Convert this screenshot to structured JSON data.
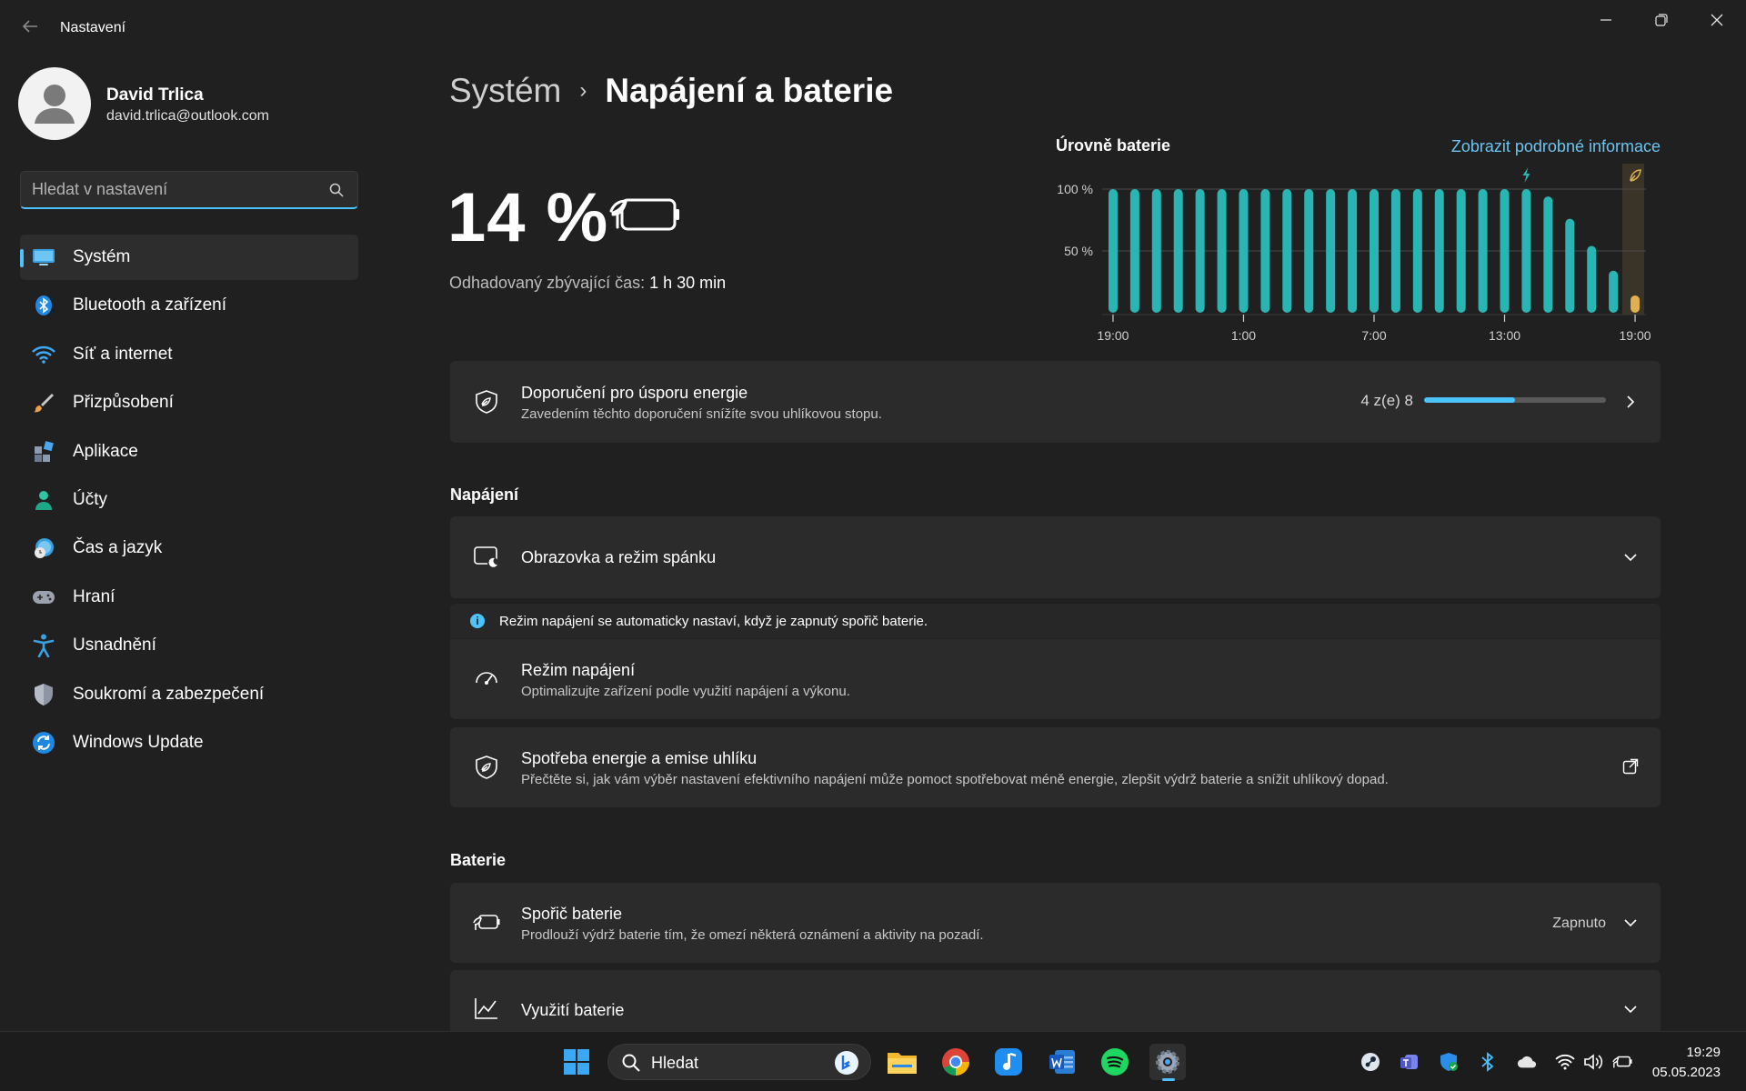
{
  "window": {
    "title": "Nastavení",
    "back_icon": "back-arrow-icon",
    "controls": [
      "minimize-icon",
      "maximize-icon",
      "close-icon"
    ]
  },
  "profile": {
    "name": "David Trlica",
    "email": "david.trlica@outlook.com"
  },
  "search": {
    "placeholder": "Hledat v nastavení",
    "icon": "search-icon"
  },
  "sidebar": {
    "items": [
      {
        "label": "Systém",
        "icon": "system-icon",
        "active": true
      },
      {
        "label": "Bluetooth a zařízení",
        "icon": "bluetooth-icon"
      },
      {
        "label": "Síť a internet",
        "icon": "wifi-icon"
      },
      {
        "label": "Přizpůsobení",
        "icon": "brush-icon"
      },
      {
        "label": "Aplikace",
        "icon": "apps-icon"
      },
      {
        "label": "Účty",
        "icon": "account-icon"
      },
      {
        "label": "Čas a jazyk",
        "icon": "time-language-icon"
      },
      {
        "label": "Hraní",
        "icon": "gamepad-icon"
      },
      {
        "label": "Usnadnění",
        "icon": "accessibility-icon"
      },
      {
        "label": "Soukromí a zabezpečení",
        "icon": "shield-icon"
      },
      {
        "label": "Windows Update",
        "icon": "update-icon"
      }
    ]
  },
  "breadcrumb": {
    "parent": "Systém",
    "separator": "›",
    "current": "Napájení a baterie"
  },
  "battery": {
    "percent": "14 %",
    "estimate_label": "Odhadovaný zbývající čas:",
    "estimate_value": "1 h 30 min"
  },
  "chart_data": {
    "type": "bar",
    "title": "Úrovně baterie",
    "link": "Zobrazit podrobné informace",
    "y_tick_labels": [
      "100 %",
      "50 %"
    ],
    "x_tick_labels": [
      "19:00",
      "1:00",
      "7:00",
      "13:00",
      "19:00"
    ],
    "ylim": [
      0,
      100
    ],
    "values": [
      100,
      100,
      100,
      100,
      100,
      100,
      100,
      100,
      100,
      100,
      100,
      100,
      100,
      100,
      100,
      100,
      100,
      100,
      100,
      100,
      94,
      76,
      54,
      34,
      14
    ],
    "colors": {
      "normal": "#2ab5b5",
      "saver": "#e0b050"
    },
    "markers": [
      "charging-bolt-icon",
      "battery-saver-leaf-icon"
    ]
  },
  "recommendations": {
    "title": "Doporučení pro úsporu energie",
    "subtitle": "Zavedením těchto doporučení snížíte svou uhlíkovou stopu.",
    "progress_text": "4 z(e) 8",
    "progress_fraction": 0.5
  },
  "power_section": {
    "label": "Napájení",
    "screen_sleep": {
      "title": "Obrazovka a režim spánku"
    },
    "info_text": "Režim napájení se automaticky nastaví, když je zapnutý spořič baterie.",
    "power_mode": {
      "title": "Režim napájení",
      "subtitle": "Optimalizujte zařízení podle využití napájení a výkonu."
    },
    "consumption": {
      "title": "Spotřeba energie a emise uhlíku",
      "subtitle": "Přečtěte si, jak vám výběr nastavení efektivního napájení může pomoct spotřebovat méně energie, zlepšit výdrž baterie a snížit uhlíkový dopad."
    }
  },
  "battery_section": {
    "label": "Baterie",
    "saver": {
      "title": "Spořič baterie",
      "subtitle": "Prodlouží výdrž baterie tím, že omezí některá oznámení a aktivity na pozadí.",
      "status": "Zapnuto"
    },
    "usage": {
      "title": "Využití baterie"
    }
  },
  "taskbar": {
    "search_label": "Hledat",
    "apps": [
      "windows-start-icon",
      "bing-icon",
      "file-explorer-icon",
      "chrome-icon",
      "music-app-icon",
      "word-icon",
      "spotify-icon",
      "settings-icon"
    ],
    "tray": [
      "steam-icon",
      "teams-icon",
      "defender-icon",
      "bluetooth-icon",
      "onedrive-icon",
      "wifi-icon",
      "volume-icon",
      "battery-icon"
    ],
    "time": "19:29",
    "date": "05.05.2023"
  },
  "colors": {
    "accent": "#4cc2ff",
    "background": "#202020",
    "card": "#2b2b2b"
  }
}
